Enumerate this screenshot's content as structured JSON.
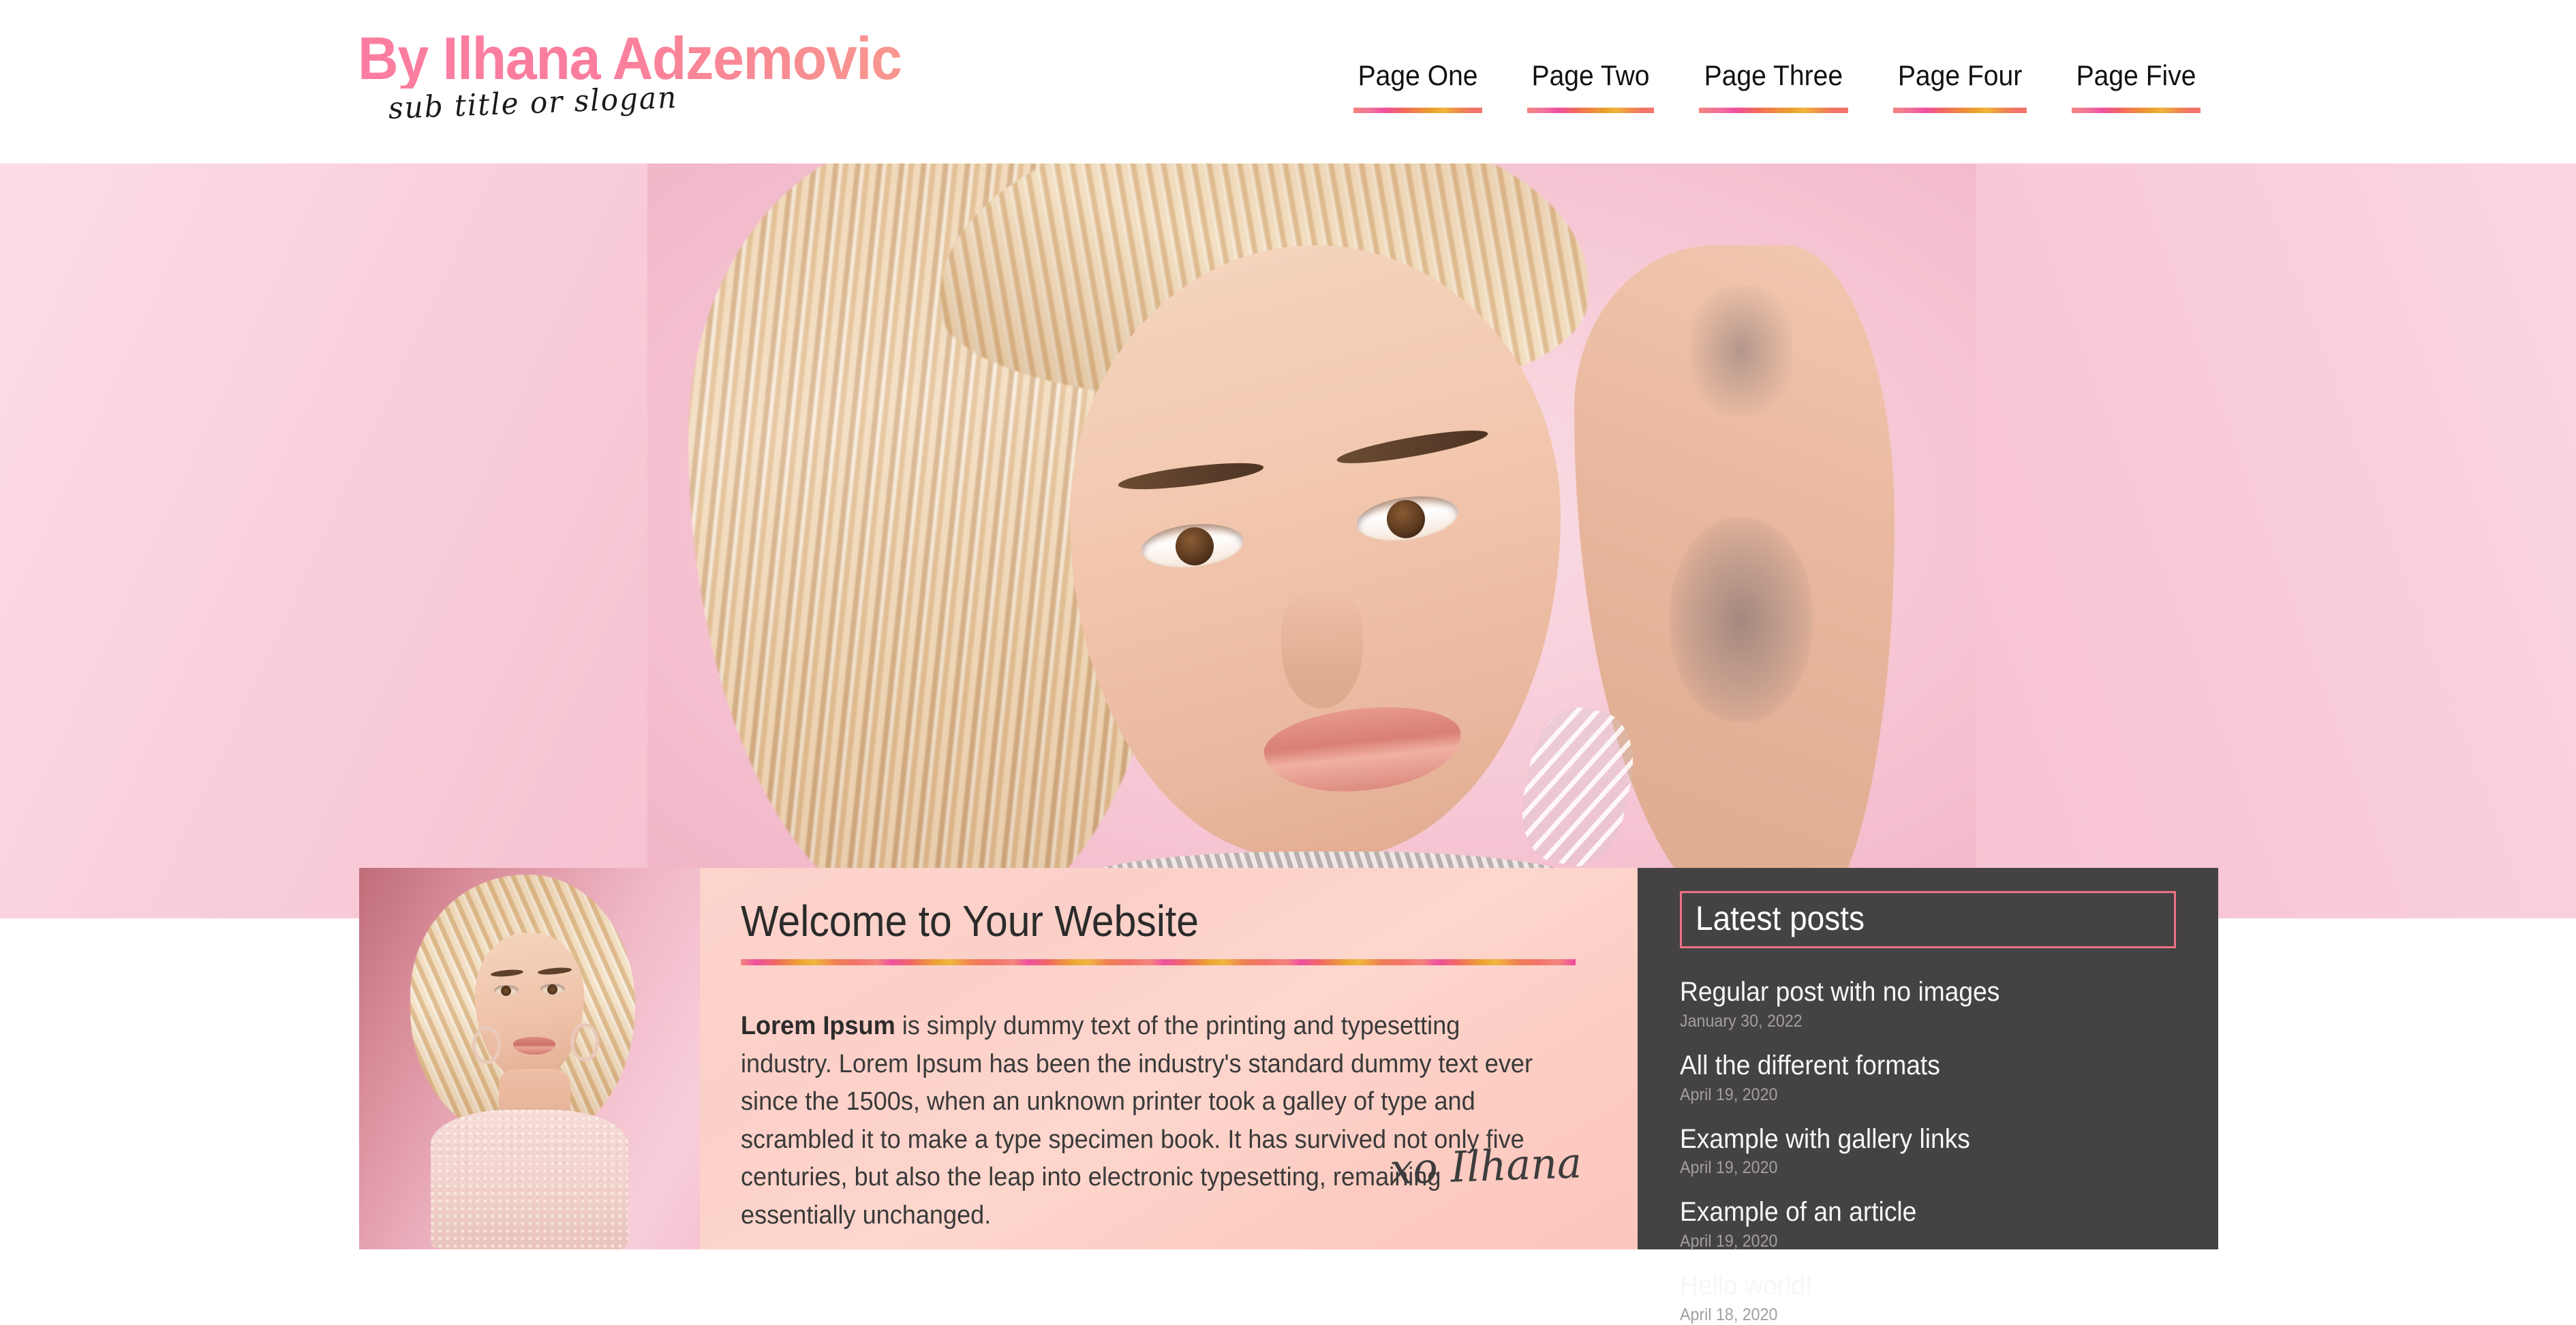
{
  "header": {
    "brand_title": "By Ilhana Adzemovic",
    "brand_slogan": "sub title or slogan",
    "nav": [
      {
        "label": "Page One"
      },
      {
        "label": "Page Two"
      },
      {
        "label": "Page Three"
      },
      {
        "label": "Page Four"
      },
      {
        "label": "Page Five"
      }
    ]
  },
  "hero": {
    "alt": "blonde woman portrait on pink background"
  },
  "main": {
    "thumbnail_alt": "blonde woman in pink sweater",
    "welcome_title": "Welcome to Your Website",
    "body_lead": "Lorem Ipsum",
    "body_text": " is simply dummy text of the printing and typesetting industry. Lorem Ipsum has been the industry's standard dummy text ever since the 1500s, when an unknown printer took a galley of type and scrambled it to make a type specimen book. It has survived not only five centuries, but also the leap into electronic typesetting, remaining essentially unchanged.",
    "signature": "xo Ilhana"
  },
  "sidebar": {
    "heading": "Latest posts",
    "posts": [
      {
        "title": "Regular post with no images",
        "date": "January 30, 2022"
      },
      {
        "title": "All the different formats",
        "date": "April 19, 2020"
      },
      {
        "title": "Example with gallery links",
        "date": "April 19, 2020"
      },
      {
        "title": "Example of an article",
        "date": "April 19, 2020"
      },
      {
        "title": "Hello world!",
        "date": "April 18, 2020"
      }
    ]
  },
  "colors": {
    "brand_pink": "#fa7f9e",
    "accent_gradient_start": "#f4857e",
    "accent_gradient_mid": "#ef4fa0",
    "accent_gradient_end": "#f0b63d",
    "sidebar_bg": "#444242",
    "sidebar_border": "#ef7186",
    "card_bg": "#fcd4cd"
  }
}
